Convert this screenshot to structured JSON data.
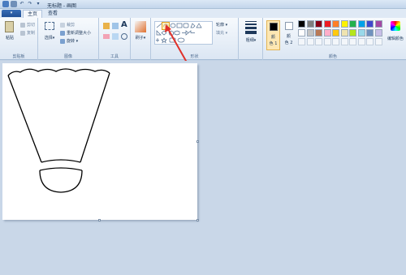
{
  "window": {
    "title": "无标题 - 画图"
  },
  "tabs": {
    "home": "主页",
    "view": "查看"
  },
  "clipboard": {
    "paste": "粘贴",
    "cut": "剪切",
    "copy": "复制",
    "label": "剪贴板"
  },
  "image": {
    "select": "选择",
    "crop": "裁剪",
    "resize": "重新调整大小",
    "rotate": "旋转",
    "label": "图像"
  },
  "tools": {
    "label": "工具",
    "text_icon": "A"
  },
  "brushes": {
    "label": "刷子"
  },
  "shapes": {
    "outline": "轮廓",
    "fill": "填充",
    "label": "形状"
  },
  "size": {
    "label": "粗细"
  },
  "color1": {
    "label1": "颜",
    "label2": "色 1"
  },
  "color2": {
    "label1": "颜",
    "label2": "色 2"
  },
  "colors": {
    "label": "颜色",
    "edit": "编辑颜色",
    "row1": [
      "#000000",
      "#7f7f7f",
      "#880015",
      "#ed1c24",
      "#ff7f27",
      "#fff200",
      "#22b14c",
      "#00a2e8",
      "#3f48cc",
      "#a349a4"
    ],
    "row2": [
      "#ffffff",
      "#c3c3c3",
      "#b97a57",
      "#ffaec9",
      "#ffc90e",
      "#efe4b0",
      "#b5e61d",
      "#99d9ea",
      "#7092be",
      "#c8bfe7"
    ]
  },
  "colors_meta": {
    "accent": "#1f4f96",
    "arrow": "#e0312a"
  }
}
